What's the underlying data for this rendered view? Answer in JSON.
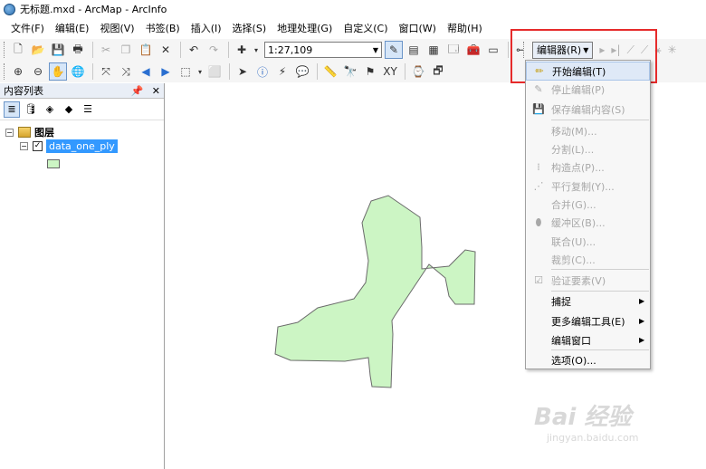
{
  "window": {
    "title": "无标题.mxd - ArcMap - ArcInfo"
  },
  "menubar": {
    "items": [
      "文件(F)",
      "编辑(E)",
      "视图(V)",
      "书签(B)",
      "插入(I)",
      "选择(S)",
      "地理处理(G)",
      "自定义(C)",
      "窗口(W)",
      "帮助(H)"
    ]
  },
  "toolbar": {
    "scale_value": "1:27,109"
  },
  "editor_toolbar": {
    "label": "编辑器(R)"
  },
  "toc": {
    "title": "内容列表",
    "group_label": "图层",
    "layer_name": "data_one_ply",
    "layer_fill": "#ccf5c4"
  },
  "editor_menu": {
    "items": [
      {
        "label": "开始编辑(T)",
        "icon": "pencil-icon",
        "enabled": true
      },
      {
        "label": "停止编辑(P)",
        "enabled": false
      },
      {
        "label": "保存编辑内容(S)",
        "enabled": false
      },
      {
        "label": "移动(M)...",
        "enabled": false
      },
      {
        "label": "分割(L)...",
        "enabled": false
      },
      {
        "label": "构造点(P)...",
        "enabled": false
      },
      {
        "label": "平行复制(Y)...",
        "enabled": false
      },
      {
        "label": "合并(G)...",
        "enabled": false
      },
      {
        "label": "缓冲区(B)...",
        "enabled": false
      },
      {
        "label": "联合(U)...",
        "enabled": false
      },
      {
        "label": "裁剪(C)...",
        "enabled": false
      },
      {
        "label": "验证要素(V)",
        "enabled": false
      },
      {
        "label": "捕捉",
        "enabled": true,
        "submenu": true
      },
      {
        "label": "更多编辑工具(E)",
        "enabled": true,
        "submenu": true
      },
      {
        "label": "编辑窗口",
        "enabled": true,
        "submenu": true
      },
      {
        "label": "选项(O)...",
        "enabled": true
      }
    ]
  },
  "watermark": {
    "brand": "Bai 经验",
    "url": "jingyan.baidu.com"
  },
  "colors": {
    "highlight_border": "#e62b2b",
    "polygon_fill": "#ccf5c4",
    "selection": "#3399ff"
  }
}
